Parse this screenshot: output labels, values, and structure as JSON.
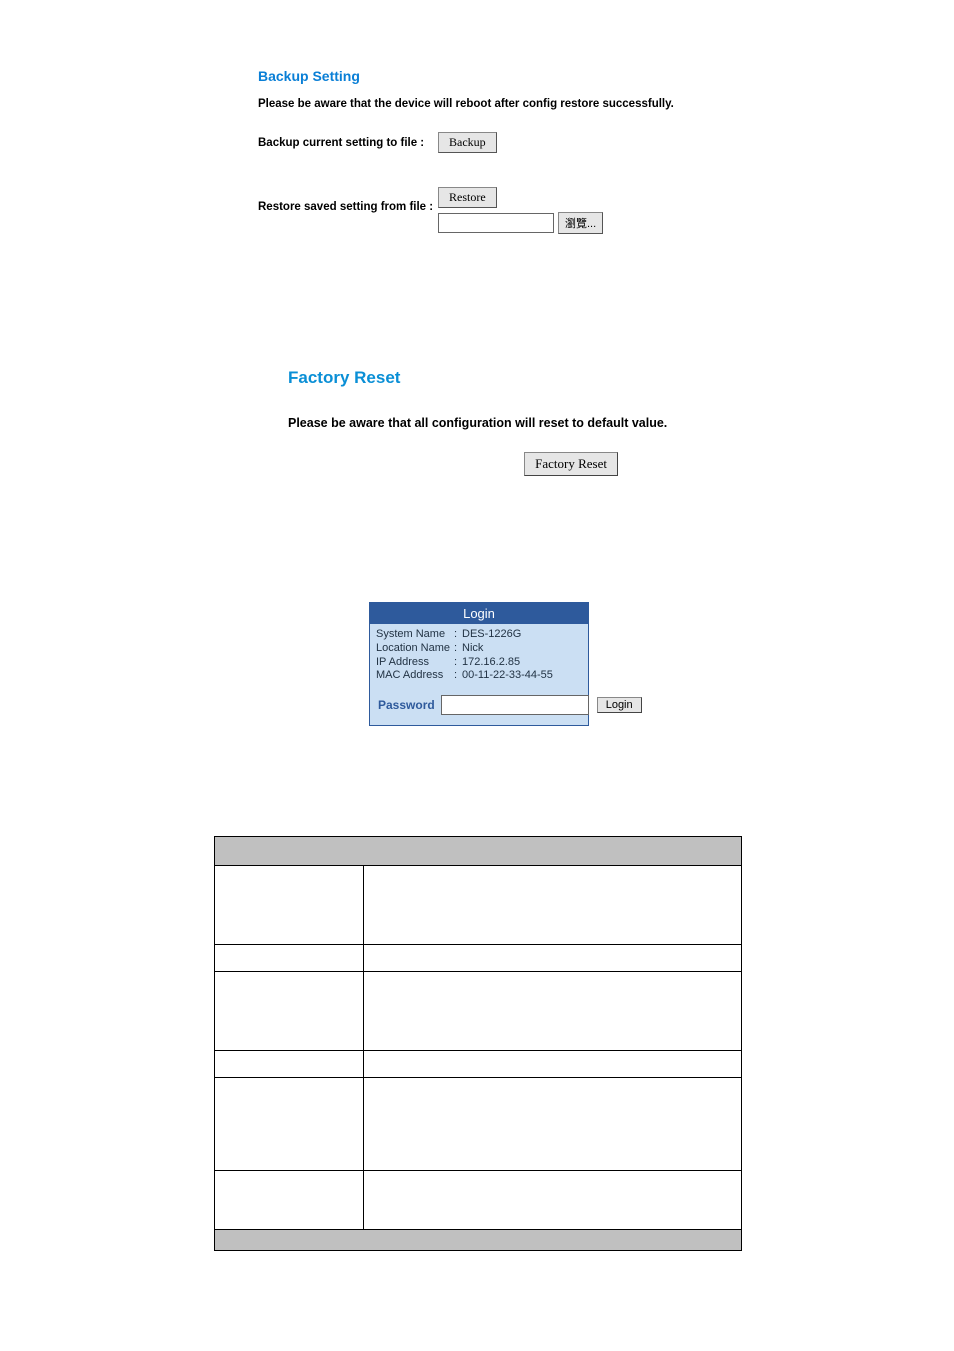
{
  "backup": {
    "title": "Backup Setting",
    "warning": "Please be aware that the device will reboot after config restore successfully.",
    "backup_label": "Backup current setting to file :",
    "backup_btn": "Backup",
    "restore_label": "Restore saved setting from file :",
    "restore_btn": "Restore",
    "file_value": "",
    "browse_btn": "瀏覽..."
  },
  "factory": {
    "title": "Factory Reset",
    "warning": "Please be aware that all configuration will reset to default value.",
    "reset_btn": "Factory Reset"
  },
  "login": {
    "header": "Login",
    "info": {
      "system_name_key": "System Name",
      "system_name_val": "DES-1226G",
      "location_name_key": "Location Name",
      "location_name_val": "Nick",
      "ip_key": "IP Address",
      "ip_val": "172.16.2.85",
      "mac_key": "MAC Address",
      "mac_val": "00-11-22-33-44-55"
    },
    "password_label": "Password",
    "password_value": "",
    "login_btn": "Login"
  }
}
